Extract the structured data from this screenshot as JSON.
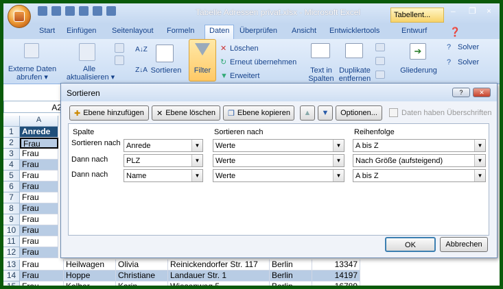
{
  "window": {
    "title": "Tabelle Adressen privat.xlsx - Microsoft Excel",
    "context_tab": "Tabellent...",
    "minimize": "–",
    "restore": "❐",
    "close": "×"
  },
  "ribbon_tabs": [
    "Start",
    "Einfügen",
    "Seitenlayout",
    "Formeln",
    "Daten",
    "Überprüfen",
    "Ansicht",
    "Entwicklertools",
    "Entwurf"
  ],
  "active_tab": "Daten",
  "ribbon": {
    "externe": "Externe Daten",
    "externe2": "abrufen ▾",
    "alle": "Alle",
    "aktualisieren": "aktualisieren ▾",
    "sortieren": "Sortieren",
    "filter": "Filter",
    "loeschen": "Löschen",
    "erneut": "Erneut übernehmen",
    "erweitert": "Erweitert",
    "text_in": "Text in",
    "spalten": "Spalten",
    "duplikate": "Duplikate",
    "entfernen": "entfernen",
    "gliederung": "Gliederung",
    "solver1": "Solver",
    "solver2": "Solver",
    "az": "A↓Z",
    "za": "Z↓A"
  },
  "namebox": "A2",
  "columns": [
    "A"
  ],
  "header_cell": "Anrede",
  "rows": [
    {
      "n": "1",
      "a": "Anrede"
    },
    {
      "n": "2",
      "a": "Frau"
    },
    {
      "n": "3",
      "a": "Frau"
    },
    {
      "n": "4",
      "a": "Frau"
    },
    {
      "n": "5",
      "a": "Frau"
    },
    {
      "n": "6",
      "a": "Frau"
    },
    {
      "n": "7",
      "a": "Frau"
    },
    {
      "n": "8",
      "a": "Frau"
    },
    {
      "n": "9",
      "a": "Frau"
    },
    {
      "n": "10",
      "a": "Frau"
    },
    {
      "n": "11",
      "a": "Frau"
    },
    {
      "n": "12",
      "a": "Frau"
    }
  ],
  "visible_rows": [
    {
      "n": "13",
      "a": "Frau",
      "b": "Heilwagen",
      "c": "Olivia",
      "d": "Reinickendorfer Str. 117",
      "e": "Berlin",
      "f": "13347"
    },
    {
      "n": "14",
      "a": "Frau",
      "b": "Hoppe",
      "c": "Christiane",
      "d": "Landauer Str. 1",
      "e": "Berlin",
      "f": "14197"
    },
    {
      "n": "15",
      "a": "Frau",
      "b": "Kelber",
      "c": "Karin",
      "d": "Wiesenweg 5",
      "e": "Berlin",
      "f": "16789"
    }
  ],
  "dialog": {
    "title": "Sortieren",
    "help": "?",
    "close": "✕",
    "add_level": "Ebene hinzufügen",
    "delete_level": "Ebene löschen",
    "copy_level": "Ebene kopieren",
    "up": "▲",
    "down": "▼",
    "options": "Optionen...",
    "has_headers": "Daten haben Überschriften",
    "col_header": "Spalte",
    "sort_on_header": "Sortieren nach",
    "order_header": "Reihenfolge",
    "levels": [
      {
        "label": "Sortieren nach",
        "column": "Anrede",
        "sort_on": "Werte",
        "order": "A bis Z"
      },
      {
        "label": "Dann nach",
        "column": "PLZ",
        "sort_on": "Werte",
        "order": "Nach Größe (aufsteigend)"
      },
      {
        "label": "Dann nach",
        "column": "Name",
        "sort_on": "Werte",
        "order": "A bis Z"
      }
    ],
    "ok": "OK",
    "cancel": "Abbrechen"
  },
  "colors": {
    "accent": "#15428b",
    "frame": "#0a5a0a",
    "row_blue": "#b8cce4",
    "header_blue": "#1f4e79"
  }
}
